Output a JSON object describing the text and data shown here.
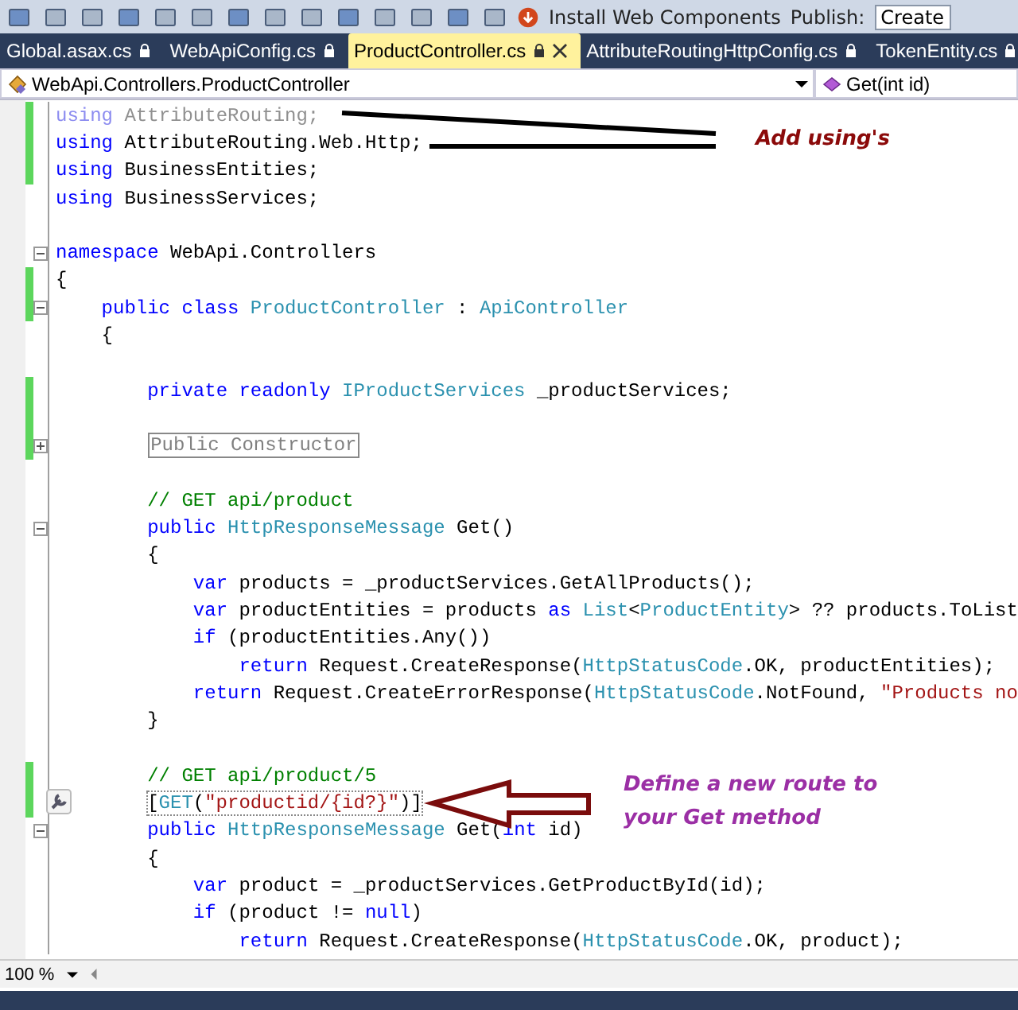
{
  "toolbar": {
    "install": "Install Web Components",
    "publish": "Publish:",
    "publish_value": "Create"
  },
  "tabs": [
    {
      "label": "Global.asax.cs",
      "selected": false
    },
    {
      "label": "WebApiConfig.cs",
      "selected": false
    },
    {
      "label": "ProductController.cs",
      "selected": true
    },
    {
      "label": "AttributeRoutingHttpConfig.cs",
      "selected": false
    },
    {
      "label": "TokenEntity.cs",
      "selected": false
    }
  ],
  "nav": {
    "type_dropdown": "WebApi.Controllers.ProductController",
    "member_dropdown": "Get(int id)"
  },
  "code": [
    {
      "changed": true,
      "kind": "code",
      "tokens": [
        {
          "kind": "faded-keyword",
          "text": "using"
        },
        {
          "kind": "faded",
          "text": " AttributeRouting;"
        }
      ]
    },
    {
      "changed": true,
      "kind": "code",
      "tokens": [
        {
          "kind": "keyword",
          "text": "using"
        },
        {
          "kind": "plain",
          "text": " AttributeRouting.Web.Http;"
        }
      ]
    },
    {
      "changed": true,
      "kind": "code",
      "tokens": [
        {
          "kind": "keyword",
          "text": "using"
        },
        {
          "kind": "plain",
          "text": " BusinessEntities;"
        }
      ]
    },
    {
      "changed": false,
      "kind": "code",
      "tokens": [
        {
          "kind": "keyword",
          "text": "using"
        },
        {
          "kind": "plain",
          "text": " BusinessServices;"
        }
      ]
    },
    {
      "changed": false,
      "kind": "blank"
    },
    {
      "changed": false,
      "foldable": true,
      "expanded": true,
      "kind": "code",
      "tokens": [
        {
          "kind": "keyword",
          "text": "namespace"
        },
        {
          "kind": "plain",
          "text": " WebApi.Controllers"
        }
      ]
    },
    {
      "changed": true,
      "kind": "code",
      "tokens": [
        {
          "kind": "plain",
          "text": "{"
        }
      ]
    },
    {
      "changed": true,
      "foldable": true,
      "expanded": true,
      "kind": "code",
      "tokens": [
        {
          "kind": "keyword",
          "text": "    public class"
        },
        {
          "kind": "type",
          "text": " ProductController"
        },
        {
          "kind": "plain",
          "text": " :"
        },
        {
          "kind": "type",
          "text": " ApiController"
        }
      ]
    },
    {
      "changed": false,
      "kind": "code",
      "tokens": [
        {
          "kind": "plain",
          "text": "    {"
        }
      ]
    },
    {
      "changed": false,
      "kind": "blank"
    },
    {
      "changed": true,
      "kind": "code",
      "tokens": [
        {
          "kind": "keyword",
          "text": "        private readonly"
        },
        {
          "kind": "type",
          "text": " IProductServices"
        },
        {
          "kind": "plain",
          "text": " _productServices;"
        }
      ]
    },
    {
      "changed": true,
      "kind": "blank"
    },
    {
      "changed": true,
      "foldable": true,
      "expanded": false,
      "kind": "region",
      "tokens": [
        {
          "kind": "collapsed",
          "text": "Public Constructor"
        }
      ]
    },
    {
      "changed": false,
      "kind": "blank"
    },
    {
      "changed": false,
      "kind": "code",
      "tokens": [
        {
          "kind": "comment",
          "text": "        // GET api/product"
        }
      ]
    },
    {
      "changed": false,
      "foldable": true,
      "expanded": true,
      "kind": "code",
      "tokens": [
        {
          "kind": "keyword",
          "text": "        public"
        },
        {
          "kind": "type",
          "text": " HttpResponseMessage"
        },
        {
          "kind": "plain",
          "text": " Get()"
        }
      ]
    },
    {
      "changed": false,
      "kind": "code",
      "tokens": [
        {
          "kind": "plain",
          "text": "        {"
        }
      ]
    },
    {
      "changed": false,
      "kind": "code",
      "tokens": [
        {
          "kind": "keyword",
          "text": "            var"
        },
        {
          "kind": "plain",
          "text": " products = _productServices.GetAllProducts();"
        }
      ]
    },
    {
      "changed": false,
      "kind": "code",
      "tokens": [
        {
          "kind": "keyword",
          "text": "            var"
        },
        {
          "kind": "plain",
          "text": " productEntities = products"
        },
        {
          "kind": "keyword",
          "text": " as"
        },
        {
          "kind": "type",
          "text": " List"
        },
        {
          "kind": "plain",
          "text": "<"
        },
        {
          "kind": "type",
          "text": "ProductEntity"
        },
        {
          "kind": "plain",
          "text": "> ?? products.ToList"
        }
      ]
    },
    {
      "changed": false,
      "kind": "code",
      "tokens": [
        {
          "kind": "keyword",
          "text": "            if"
        },
        {
          "kind": "plain",
          "text": " (productEntities.Any())"
        }
      ]
    },
    {
      "changed": false,
      "kind": "code",
      "tokens": [
        {
          "kind": "keyword",
          "text": "                return"
        },
        {
          "kind": "plain",
          "text": " Request.CreateResponse("
        },
        {
          "kind": "type",
          "text": "HttpStatusCode"
        },
        {
          "kind": "plain",
          "text": ".OK, productEntities);"
        }
      ]
    },
    {
      "changed": false,
      "kind": "code",
      "tokens": [
        {
          "kind": "keyword",
          "text": "            return"
        },
        {
          "kind": "plain",
          "text": " Request.CreateErrorResponse("
        },
        {
          "kind": "type",
          "text": "HttpStatusCode"
        },
        {
          "kind": "plain",
          "text": ".NotFound,"
        },
        {
          "kind": "string",
          "text": " \"Products no"
        }
      ]
    },
    {
      "changed": false,
      "kind": "code",
      "tokens": [
        {
          "kind": "plain",
          "text": "        }"
        }
      ]
    },
    {
      "changed": false,
      "kind": "blank"
    },
    {
      "changed": true,
      "kind": "code",
      "tokens": [
        {
          "kind": "comment",
          "text": "        // GET api/product/5"
        }
      ]
    },
    {
      "changed": true,
      "kind": "attribute",
      "tokens": [
        {
          "kind": "plain",
          "text": "["
        },
        {
          "kind": "type",
          "text": "GET"
        },
        {
          "kind": "plain",
          "text": "("
        },
        {
          "kind": "string",
          "text": "\"productid/{id?}\""
        },
        {
          "kind": "plain",
          "text": ")]"
        }
      ]
    },
    {
      "changed": false,
      "foldable": true,
      "expanded": true,
      "kind": "code",
      "tokens": [
        {
          "kind": "keyword",
          "text": "        public"
        },
        {
          "kind": "type",
          "text": " HttpResponseMessage"
        },
        {
          "kind": "plain",
          "text": " Get("
        },
        {
          "kind": "keyword",
          "text": "int"
        },
        {
          "kind": "plain",
          "text": " id)"
        }
      ]
    },
    {
      "changed": false,
      "kind": "code",
      "tokens": [
        {
          "kind": "plain",
          "text": "        {"
        }
      ]
    },
    {
      "changed": false,
      "kind": "code",
      "tokens": [
        {
          "kind": "keyword",
          "text": "            var"
        },
        {
          "kind": "plain",
          "text": " product = _productServices.GetProductById(id);"
        }
      ]
    },
    {
      "changed": false,
      "kind": "code",
      "tokens": [
        {
          "kind": "keyword",
          "text": "            if"
        },
        {
          "kind": "plain",
          "text": " (product != "
        },
        {
          "kind": "keyword",
          "text": "null"
        },
        {
          "kind": "plain",
          "text": ")"
        }
      ]
    },
    {
      "changed": false,
      "kind": "code",
      "tokens": [
        {
          "kind": "keyword",
          "text": "                return"
        },
        {
          "kind": "plain",
          "text": " Request.CreateResponse("
        },
        {
          "kind": "type",
          "text": "HttpStatusCode"
        },
        {
          "kind": "plain",
          "text": ".OK, product);"
        }
      ]
    }
  ],
  "annotations": {
    "add_usings": "Add using's",
    "define_route": "Define a new route to your Get method"
  },
  "status_bar": {
    "zoom": "100 %"
  }
}
